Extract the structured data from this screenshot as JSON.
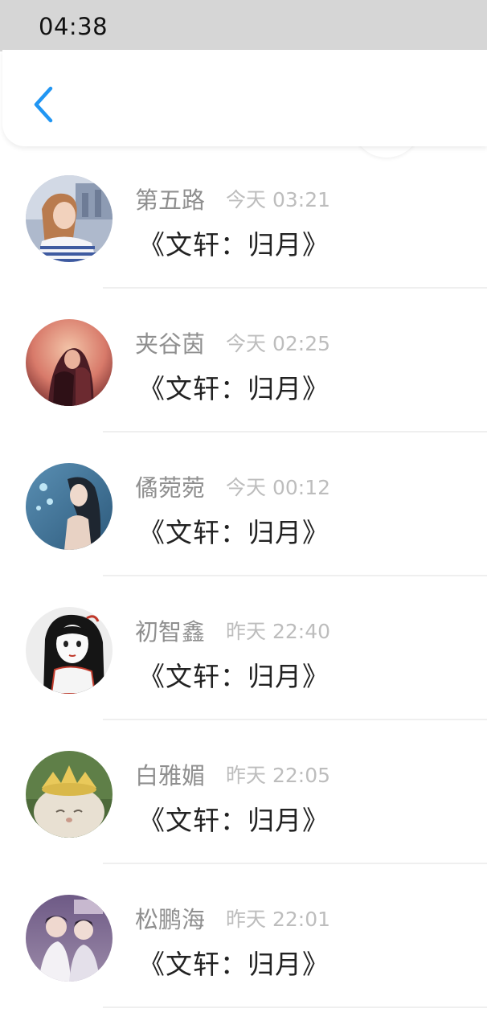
{
  "status_bar": {
    "time": "04:38"
  },
  "header": {
    "back_icon": "chevron-left-icon",
    "accent_color": "#2196F3"
  },
  "messages": [
    {
      "name": "第五路",
      "time": "今天 03:21",
      "text": "《文轩：归月》"
    },
    {
      "name": "夹谷茵",
      "time": "今天 02:25",
      "text": "《文轩：归月》"
    },
    {
      "name": "僪菀菀",
      "time": "今天 00:12",
      "text": "《文轩：归月》"
    },
    {
      "name": "初智鑫",
      "time": "昨天 22:40",
      "text": "《文轩：归月》"
    },
    {
      "name": "白雅媚",
      "time": "昨天 22:05",
      "text": "《文轩：归月》"
    },
    {
      "name": "松鹏海",
      "time": "昨天 22:01",
      "text": "《文轩：归月》"
    }
  ]
}
